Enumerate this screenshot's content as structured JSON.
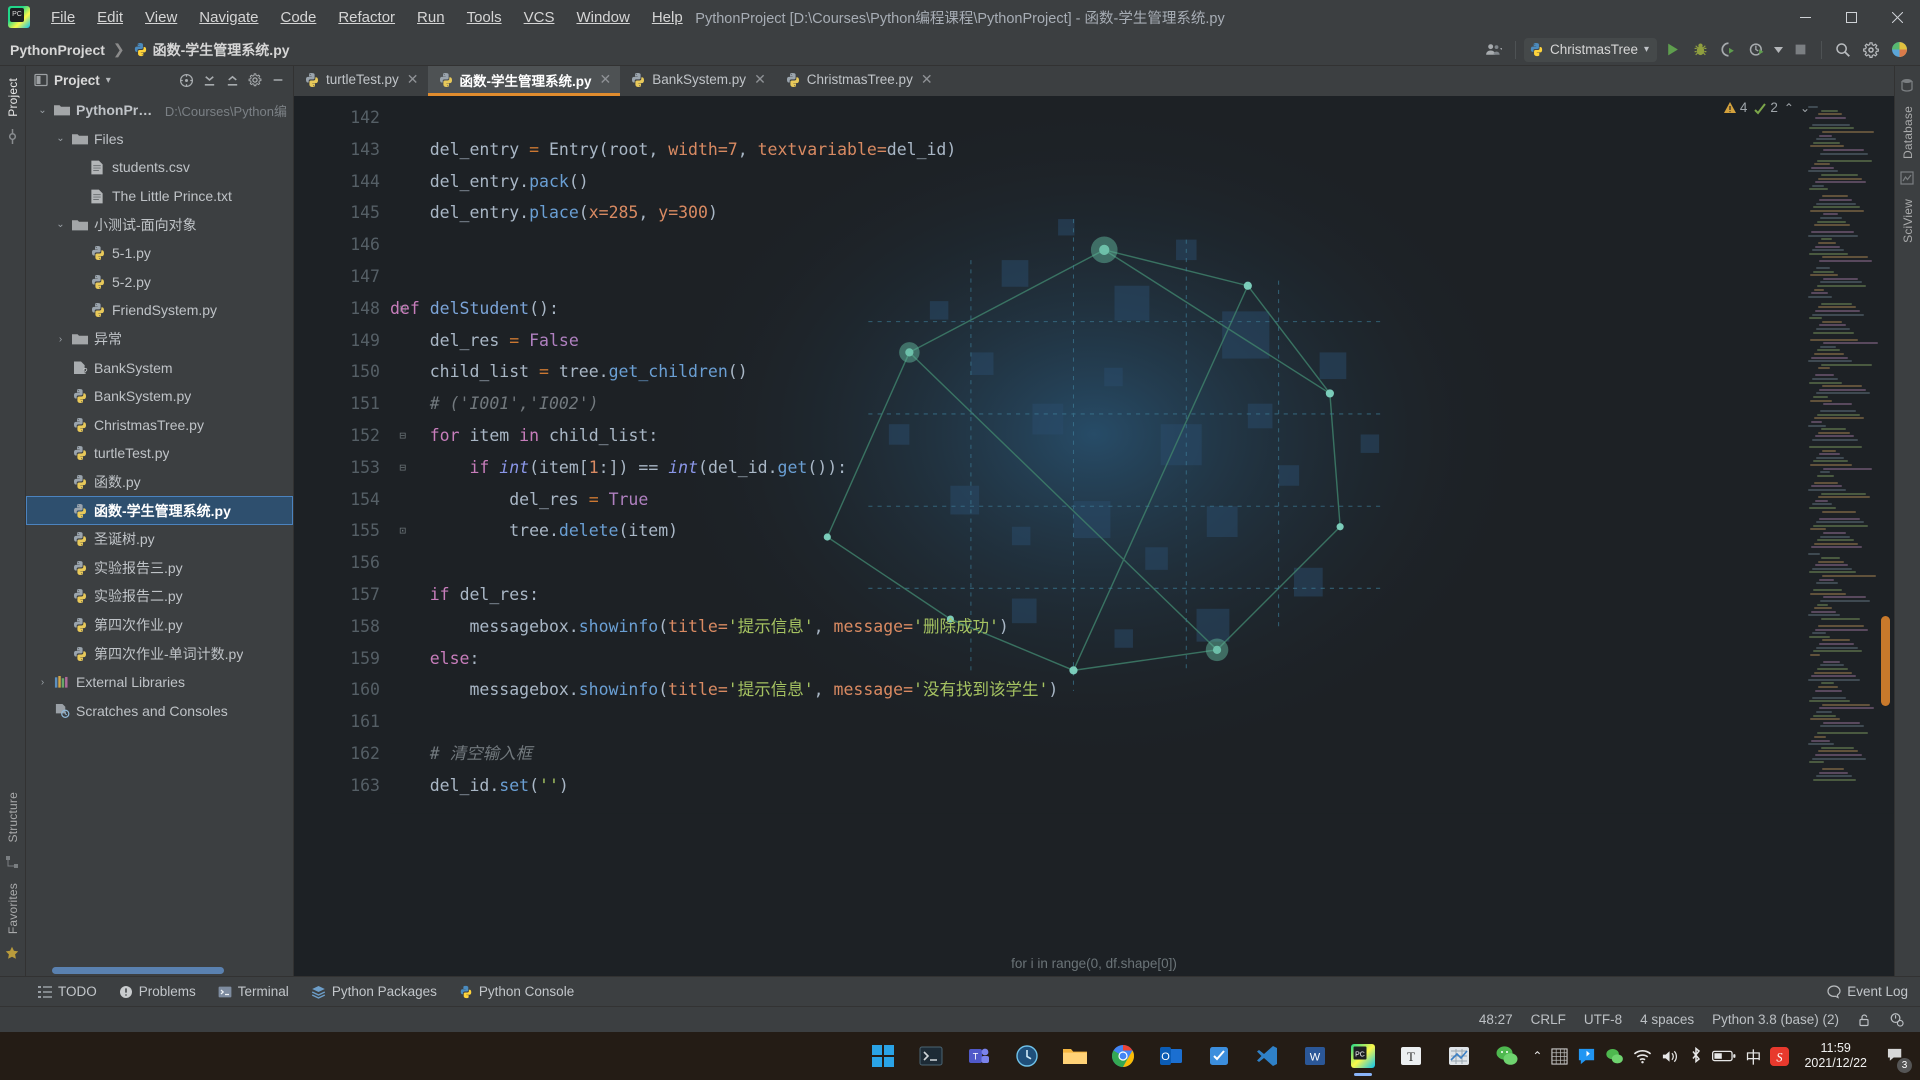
{
  "window": {
    "title": "PythonProject [D:\\Courses\\Python编程课程\\PythonProject] - 函数-学生管理系统.py",
    "minimize": "–",
    "maximize": "▢",
    "close": "✕"
  },
  "menubar": [
    {
      "label": "File"
    },
    {
      "label": "Edit"
    },
    {
      "label": "View"
    },
    {
      "label": "Navigate"
    },
    {
      "label": "Code"
    },
    {
      "label": "Refactor"
    },
    {
      "label": "Run"
    },
    {
      "label": "Tools"
    },
    {
      "label": "VCS"
    },
    {
      "label": "Window"
    },
    {
      "label": "Help"
    }
  ],
  "navbar": {
    "breadcrumb_root": "PythonProject",
    "breadcrumb_sep": "❯",
    "breadcrumb_file": "函数-学生管理系统.py",
    "run_config": "ChristmasTree",
    "run_config_caret": "▾",
    "search_icon": "search-icon",
    "settings_icon": "gear-icon"
  },
  "rails": {
    "left_top": [
      "Project"
    ],
    "left_bottom": [
      "Structure",
      "Favorites"
    ],
    "right": [
      "Database",
      "SciView"
    ]
  },
  "project_panel": {
    "title": "Project",
    "caret": "▾",
    "tree": [
      {
        "depth": 0,
        "twist": "⌄",
        "icon": "folder-icon",
        "label": "PythonProject",
        "path": "D:\\Courses\\Python编",
        "bold": true
      },
      {
        "depth": 1,
        "twist": "⌄",
        "icon": "folder-icon",
        "label": "Files"
      },
      {
        "depth": 2,
        "twist": "",
        "icon": "file-icon",
        "label": "students.csv"
      },
      {
        "depth": 2,
        "twist": "",
        "icon": "file-icon",
        "label": "The Little Prince.txt"
      },
      {
        "depth": 1,
        "twist": "⌄",
        "icon": "folder-icon",
        "label": "小测试-面向对象"
      },
      {
        "depth": 2,
        "twist": "",
        "icon": "python-icon",
        "label": "5-1.py"
      },
      {
        "depth": 2,
        "twist": "",
        "icon": "python-icon",
        "label": "5-2.py"
      },
      {
        "depth": 2,
        "twist": "",
        "icon": "python-icon",
        "label": "FriendSystem.py"
      },
      {
        "depth": 1,
        "twist": "›",
        "icon": "folder-icon",
        "label": "异常"
      },
      {
        "depth": 1,
        "twist": "",
        "icon": "python-unknown-icon",
        "label": "BankSystem"
      },
      {
        "depth": 1,
        "twist": "",
        "icon": "python-icon",
        "label": "BankSystem.py"
      },
      {
        "depth": 1,
        "twist": "",
        "icon": "python-icon",
        "label": "ChristmasTree.py"
      },
      {
        "depth": 1,
        "twist": "",
        "icon": "python-icon",
        "label": "turtleTest.py"
      },
      {
        "depth": 1,
        "twist": "",
        "icon": "python-icon",
        "label": "函数.py"
      },
      {
        "depth": 1,
        "twist": "",
        "icon": "python-icon",
        "label": "函数-学生管理系统.py",
        "selected": true
      },
      {
        "depth": 1,
        "twist": "",
        "icon": "python-icon",
        "label": "圣诞树.py"
      },
      {
        "depth": 1,
        "twist": "",
        "icon": "python-icon",
        "label": "实验报告三.py"
      },
      {
        "depth": 1,
        "twist": "",
        "icon": "python-icon",
        "label": "实验报告二.py"
      },
      {
        "depth": 1,
        "twist": "",
        "icon": "python-icon",
        "label": "第四次作业.py"
      },
      {
        "depth": 1,
        "twist": "",
        "icon": "python-icon",
        "label": "第四次作业-单词计数.py"
      },
      {
        "depth": 0,
        "twist": "›",
        "icon": "library-icon",
        "label": "External Libraries"
      },
      {
        "depth": 0,
        "twist": "",
        "icon": "scratches-icon",
        "label": "Scratches and Consoles"
      }
    ]
  },
  "editor": {
    "tabs": [
      {
        "label": "turtleTest.py",
        "active": false,
        "close": "✕"
      },
      {
        "label": "函数-学生管理系统.py",
        "active": true,
        "close": "✕"
      },
      {
        "label": "BankSystem.py",
        "active": false,
        "close": "✕"
      },
      {
        "label": "ChristmasTree.py",
        "active": false,
        "close": "✕"
      }
    ],
    "inspections": {
      "warnings": "4",
      "weak_warnings": "2",
      "up": "⌃",
      "down": "⌄"
    },
    "first_line_number": 142,
    "lines": [
      {
        "n": 142,
        "fold": "",
        "tokens": []
      },
      {
        "n": 143,
        "fold": "",
        "tokens": [
          {
            "t": "    del_entry ",
            "c": "pl"
          },
          {
            "t": "=",
            "c": "k"
          },
          {
            "t": " ",
            "c": "pl"
          },
          {
            "t": "Entry",
            "c": "pl"
          },
          {
            "t": "(",
            "c": "pl"
          },
          {
            "t": "root",
            "c": "pl"
          },
          {
            "t": ", ",
            "c": "pl"
          },
          {
            "t": "width",
            "c": "num"
          },
          {
            "t": "=",
            "c": "num"
          },
          {
            "t": "7",
            "c": "num"
          },
          {
            "t": ", ",
            "c": "pl"
          },
          {
            "t": "textvariable",
            "c": "num"
          },
          {
            "t": "=",
            "c": "num"
          },
          {
            "t": "del_id",
            "c": "pl"
          },
          {
            "t": ")",
            "c": "pl"
          }
        ]
      },
      {
        "n": 144,
        "fold": "",
        "tokens": [
          {
            "t": "    del_entry.",
            "c": "pl"
          },
          {
            "t": "pack",
            "c": "fn"
          },
          {
            "t": "()",
            "c": "pl"
          }
        ]
      },
      {
        "n": 145,
        "fold": "",
        "tokens": [
          {
            "t": "    del_entry.",
            "c": "pl"
          },
          {
            "t": "place",
            "c": "fn"
          },
          {
            "t": "(",
            "c": "pl"
          },
          {
            "t": "x",
            "c": "num"
          },
          {
            "t": "=",
            "c": "num"
          },
          {
            "t": "285",
            "c": "num"
          },
          {
            "t": ", ",
            "c": "pl"
          },
          {
            "t": "y",
            "c": "num"
          },
          {
            "t": "=",
            "c": "num"
          },
          {
            "t": "300",
            "c": "num"
          },
          {
            "t": ")",
            "c": "pl"
          }
        ]
      },
      {
        "n": 146,
        "fold": "",
        "tokens": []
      },
      {
        "n": 147,
        "fold": "",
        "tokens": []
      },
      {
        "n": 148,
        "fold": "⊟",
        "tokens": [
          {
            "t": "def ",
            "c": "def"
          },
          {
            "t": "delStudent",
            "c": "cls"
          },
          {
            "t": "():",
            "c": "pl"
          }
        ]
      },
      {
        "n": 149,
        "fold": "",
        "tokens": [
          {
            "t": "    del_res ",
            "c": "pl"
          },
          {
            "t": "=",
            "c": "k"
          },
          {
            "t": " ",
            "c": "pl"
          },
          {
            "t": "False",
            "c": "kp"
          }
        ]
      },
      {
        "n": 150,
        "fold": "",
        "tokens": [
          {
            "t": "    child_list ",
            "c": "pl"
          },
          {
            "t": "=",
            "c": "k"
          },
          {
            "t": " tree.",
            "c": "pl"
          },
          {
            "t": "get_children",
            "c": "fn"
          },
          {
            "t": "()",
            "c": "pl"
          }
        ]
      },
      {
        "n": 151,
        "fold": "",
        "tokens": [
          {
            "t": "    # ('I001','I002')",
            "c": "cm"
          }
        ]
      },
      {
        "n": 152,
        "fold": "⊟",
        "tokens": [
          {
            "t": "    ",
            "c": "pl"
          },
          {
            "t": "for ",
            "c": "def"
          },
          {
            "t": "item ",
            "c": "pl"
          },
          {
            "t": "in ",
            "c": "def"
          },
          {
            "t": "child_list:",
            "c": "pl"
          }
        ]
      },
      {
        "n": 153,
        "fold": "⊟",
        "tokens": [
          {
            "t": "        ",
            "c": "pl"
          },
          {
            "t": "if ",
            "c": "def"
          },
          {
            "t": "int",
            "c": "bi"
          },
          {
            "t": "(item[",
            "c": "pl"
          },
          {
            "t": "1",
            "c": "num"
          },
          {
            "t": ":]) ",
            "c": "pl"
          },
          {
            "t": "==",
            "c": "pl"
          },
          {
            "t": " ",
            "c": "pl"
          },
          {
            "t": "int",
            "c": "bi"
          },
          {
            "t": "(del_id.",
            "c": "pl"
          },
          {
            "t": "get",
            "c": "fn"
          },
          {
            "t": "()):",
            "c": "pl"
          }
        ]
      },
      {
        "n": 154,
        "fold": "",
        "tokens": [
          {
            "t": "            del_res ",
            "c": "pl"
          },
          {
            "t": "=",
            "c": "k"
          },
          {
            "t": " ",
            "c": "pl"
          },
          {
            "t": "True",
            "c": "kp"
          }
        ]
      },
      {
        "n": 155,
        "fold": "⊡",
        "tokens": [
          {
            "t": "            tree.",
            "c": "pl"
          },
          {
            "t": "delete",
            "c": "fn"
          },
          {
            "t": "(item)",
            "c": "pl"
          }
        ]
      },
      {
        "n": 156,
        "fold": "",
        "tokens": []
      },
      {
        "n": 157,
        "fold": "",
        "tokens": [
          {
            "t": "    ",
            "c": "pl"
          },
          {
            "t": "if ",
            "c": "def"
          },
          {
            "t": "del_res:",
            "c": "pl"
          }
        ]
      },
      {
        "n": 158,
        "fold": "",
        "tokens": [
          {
            "t": "        messagebox.",
            "c": "pl"
          },
          {
            "t": "showinfo",
            "c": "fn"
          },
          {
            "t": "(",
            "c": "pl"
          },
          {
            "t": "title",
            "c": "num"
          },
          {
            "t": "=",
            "c": "num"
          },
          {
            "t": "'提示信息'",
            "c": "str"
          },
          {
            "t": ", ",
            "c": "pl"
          },
          {
            "t": "message",
            "c": "num"
          },
          {
            "t": "=",
            "c": "num"
          },
          {
            "t": "'删除成功'",
            "c": "str"
          },
          {
            "t": ")",
            "c": "pl"
          }
        ]
      },
      {
        "n": 159,
        "fold": "",
        "tokens": [
          {
            "t": "    ",
            "c": "pl"
          },
          {
            "t": "else",
            "c": "def"
          },
          {
            "t": ":",
            "c": "pl"
          }
        ]
      },
      {
        "n": 160,
        "fold": "",
        "tokens": [
          {
            "t": "        messagebox.",
            "c": "pl"
          },
          {
            "t": "showinfo",
            "c": "fn"
          },
          {
            "t": "(",
            "c": "pl"
          },
          {
            "t": "title",
            "c": "num"
          },
          {
            "t": "=",
            "c": "num"
          },
          {
            "t": "'提示信息'",
            "c": "str"
          },
          {
            "t": ", ",
            "c": "pl"
          },
          {
            "t": "message",
            "c": "num"
          },
          {
            "t": "=",
            "c": "num"
          },
          {
            "t": "'没有找到该学生'",
            "c": "str"
          },
          {
            "t": ")",
            "c": "pl"
          }
        ]
      },
      {
        "n": 161,
        "fold": "",
        "tokens": []
      },
      {
        "n": 162,
        "fold": "",
        "tokens": [
          {
            "t": "    # 清空输入框",
            "c": "cm"
          }
        ]
      },
      {
        "n": 163,
        "fold": "",
        "tokens": [
          {
            "t": "    del_id.",
            "c": "pl"
          },
          {
            "t": "set",
            "c": "fn"
          },
          {
            "t": "(",
            "c": "pl"
          },
          {
            "t": "''",
            "c": "str"
          },
          {
            "t": ")",
            "c": "pl"
          }
        ]
      }
    ],
    "bottom_hint": "for i in range(0, df.shape[0])"
  },
  "toolwindows": [
    {
      "label": "TODO",
      "icon": "todo-icon"
    },
    {
      "label": "Problems",
      "icon": "problems-icon"
    },
    {
      "label": "Terminal",
      "icon": "terminal-icon"
    },
    {
      "label": "Python Packages",
      "icon": "packages-icon"
    },
    {
      "label": "Python Console",
      "icon": "python-console-icon"
    }
  ],
  "event_log": {
    "label": "Event Log",
    "icon": "balloon-icon"
  },
  "statusbar": {
    "caret": "48:27",
    "line_separator": "CRLF",
    "encoding": "UTF-8",
    "indent": "4 spaces",
    "interpreter": "Python 3.8 (base) (2)",
    "lock_icon": "unlocked-icon",
    "inspector_icon": "inspection-icon"
  },
  "taskbar": {
    "items": [
      {
        "name": "start-button",
        "icon": "windows-logo"
      },
      {
        "name": "terminal",
        "icon": "terminal-icon"
      },
      {
        "name": "teams",
        "icon": "teams-icon"
      },
      {
        "name": "clock-app",
        "icon": "clock-icon"
      },
      {
        "name": "file-explorer",
        "icon": "folder-icon"
      },
      {
        "name": "chrome",
        "icon": "chrome-icon"
      },
      {
        "name": "outlook",
        "icon": "outlook-icon"
      },
      {
        "name": "notes",
        "icon": "notes-icon"
      },
      {
        "name": "vscode",
        "icon": "vscode-icon"
      },
      {
        "name": "word",
        "icon": "word-icon"
      },
      {
        "name": "pycharm",
        "icon": "pycharm-icon",
        "running": true
      },
      {
        "name": "typora",
        "icon": "typora-icon"
      },
      {
        "name": "excel",
        "icon": "excel-icon"
      },
      {
        "name": "wechat",
        "icon": "wechat-icon"
      }
    ],
    "tray": {
      "expand": "⌃",
      "icons": [
        "grid-icon",
        "bluetooth-message-icon",
        "wechat-icon",
        "wifi-icon",
        "volume-icon",
        "bluetooth-icon",
        "battery-icon"
      ],
      "ime": "中",
      "sogou": "S",
      "time": "11:59",
      "date": "2021/12/22",
      "notification_count": "3"
    }
  },
  "colors": {
    "accent": "#e08c2e",
    "selection": "#2e4f6e",
    "panel": "#3c3f41",
    "editor_bg": "#1d2125",
    "string": "#a5c261",
    "keyword": "#c77dbb"
  }
}
